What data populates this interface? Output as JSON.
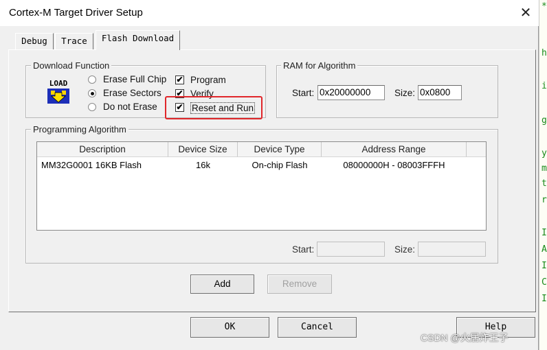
{
  "window": {
    "title": "Cortex-M Target Driver Setup",
    "close_label": "✕"
  },
  "tabs": [
    {
      "label": "Debug"
    },
    {
      "label": "Trace"
    },
    {
      "label": "Flash Download"
    }
  ],
  "download_function": {
    "legend": "Download Function",
    "icon_text": "LOAD",
    "erase_options": [
      {
        "label": "Erase Full Chip",
        "selected": false
      },
      {
        "label": "Erase Sectors",
        "selected": true
      },
      {
        "label": "Do not Erase",
        "selected": false
      }
    ],
    "checks": [
      {
        "label": "Program",
        "checked": true
      },
      {
        "label": "Verify",
        "checked": true
      },
      {
        "label": "Reset and Run",
        "checked": true
      }
    ],
    "check_mark": "✔"
  },
  "ram_for_algorithm": {
    "legend": "RAM for Algorithm",
    "start_label": "Start:",
    "start_value": "0x20000000",
    "size_label": "Size:",
    "size_value": "0x0800"
  },
  "programming_algorithm": {
    "legend": "Programming Algorithm",
    "columns": [
      "Description",
      "Device Size",
      "Device Type",
      "Address Range"
    ],
    "rows": [
      [
        "MM32G0001 16KB Flash",
        "16k",
        "On-chip Flash",
        "08000000H - 08003FFFH"
      ]
    ],
    "start_label": "Start:",
    "start_value": "",
    "size_label": "Size:",
    "size_value": ""
  },
  "buttons": {
    "add": "Add",
    "remove": "Remove",
    "ok": "OK",
    "cancel": "Cancel",
    "help": "Help"
  },
  "background_code_chars": [
    "*",
    "h",
    "i",
    "g",
    "y",
    "m",
    "t",
    "r",
    "I",
    "A",
    "I",
    "C",
    "I"
  ],
  "watermark": "CSDN @火居炸王子",
  "colors": {
    "highlight_box": "#e0262a",
    "background_code": "#1a8a1a"
  }
}
